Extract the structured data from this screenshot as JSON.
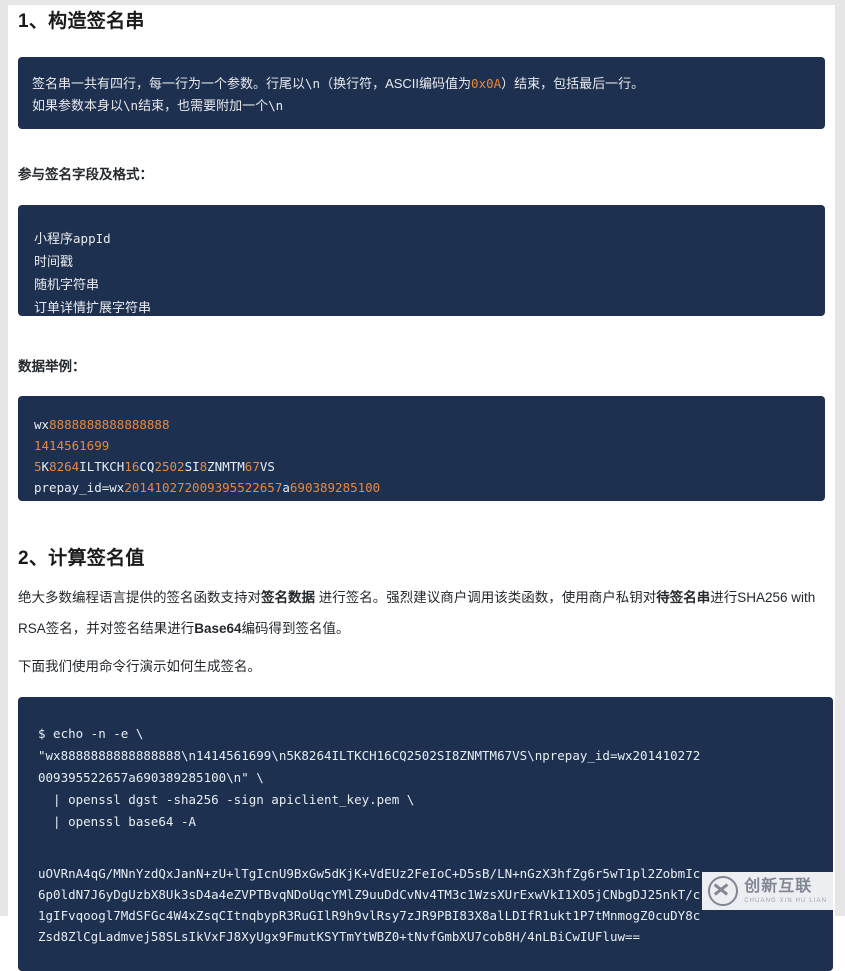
{
  "sections": [
    {
      "heading": "1、构造签名串",
      "note": {
        "line1_pre": "签名串一共有四行，每一行为一个参数。行尾以",
        "line1_mono1": "\\n",
        "line1_mid": "（换行符，ASCII编码值为",
        "line1_hex": "0x0A",
        "line1_post": "）结束，包括最后一行。",
        "line2_pre": "如果参数本身以",
        "line2_mono1": "\\n",
        "line2_mid": "结束，也需要附加一个",
        "line2_mono2": "\\n"
      },
      "fields_label": "参与签名字段及格式：",
      "fields": [
        {
          "cn": "小程序",
          "en": "appId"
        },
        {
          "cn": "时间戳",
          "en": ""
        },
        {
          "cn": "随机字符串",
          "en": ""
        },
        {
          "cn": "订单详情扩展字符串",
          "en": ""
        }
      ],
      "example_label": "数据举例：",
      "example_lines": [
        [
          {
            "t": "wx",
            "k": "txt"
          },
          {
            "t": "8888888888888888",
            "k": "num"
          }
        ],
        [
          {
            "t": "1414561699",
            "k": "num"
          }
        ],
        [
          {
            "t": "5",
            "k": "num"
          },
          {
            "t": "K",
            "k": "txt"
          },
          {
            "t": "8264",
            "k": "num"
          },
          {
            "t": "ILTKCH",
            "k": "txt"
          },
          {
            "t": "16",
            "k": "num"
          },
          {
            "t": "CQ",
            "k": "txt"
          },
          {
            "t": "2502",
            "k": "num"
          },
          {
            "t": "SI",
            "k": "txt"
          },
          {
            "t": "8",
            "k": "num"
          },
          {
            "t": "ZNMTM",
            "k": "txt"
          },
          {
            "t": "67",
            "k": "num"
          },
          {
            "t": "VS",
            "k": "txt"
          }
        ],
        [
          {
            "t": "prepay_id=wx",
            "k": "txt"
          },
          {
            "t": "201410272009395522657",
            "k": "num"
          },
          {
            "t": "a",
            "k": "txt"
          },
          {
            "t": "690389285100",
            "k": "num"
          }
        ]
      ]
    },
    {
      "heading": "2、计算签名值",
      "paragraph": {
        "p1": "绝大多数编程语言提供的签名函数支持对",
        "b1": "签名数据",
        "p2": " 进行签名。强烈建议商户调用该类函数，使用商户私钥对",
        "b2": "待签名串",
        "p3": "进行SHA256 with RSA签名，并对签名结果进行",
        "b3": "Base64",
        "p4": "编码得到签名值。"
      },
      "paragraph2": "下面我们使用命令行演示如何生成签名。",
      "shell_lines": [
        "$ echo -n -e \\",
        "\"wx8888888888888888\\n1414561699\\n5K8264ILTKCH16CQ2502SI8ZNMTM67VS\\nprepay_id=wx201410272",
        "009395522657a690389285100\\n\" \\",
        "  | openssl dgst -sha256 -sign apiclient_key.pem \\",
        "  | openssl base64 -A"
      ],
      "base64_lines": [
        "uOVRnA4qG/MNnYzdQxJanN+zU+lTgIcnU9BxGw5dKjK+VdEUz2FeIoC+D5sB/LN+nGzX3hfZg6r5wT1pl2ZobmIc",
        "6p0ldN7J6yDgUzbX8Uk3sD4a4eZVPTBvqNDoUqcYMlZ9uuDdCvNv4TM3c1WzsXUrExwVkI1XO5jCNbgDJ25nkT/c",
        "1gIFvqoogl7MdSFGc4W4xZsqCItnqbypR3RuGIlR9h9vlRsy7zJR9PBI83X8alLDIfR1ukt1P7tMnmogZ0cuDY8c",
        "Zsd8ZlCgLadmvej58SLsIkVxFJ8XyUgx9FmutKSYTmYtWBZ0+tNvfGmbXU7cob8H/4nLBiCwIUFluw=="
      ]
    }
  ],
  "watermark": {
    "cn": "创新互联",
    "pinyin": "CHUANG XIN HU LIAN"
  },
  "colors": {
    "panel_bg": "#1e3050",
    "accent_number": "#e8883b",
    "page_bg": "#ffffff",
    "rail": "#e6e6e6"
  }
}
